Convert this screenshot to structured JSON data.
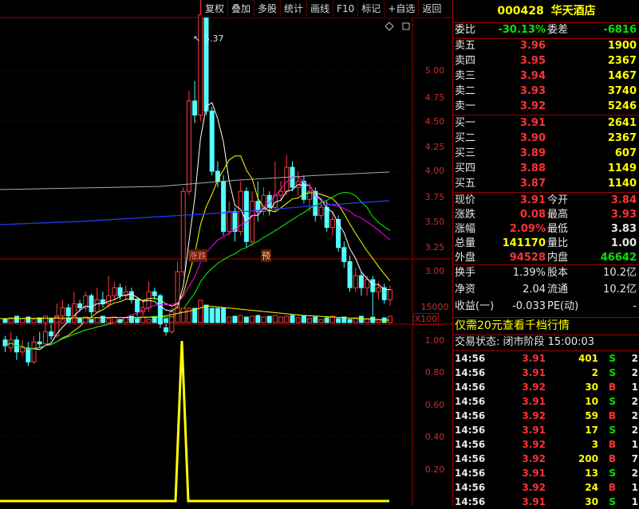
{
  "toolbar": {
    "items": [
      "复权",
      "叠加",
      "多股",
      "统计",
      "画线",
      "F10",
      "标记",
      "+自选",
      "返回"
    ]
  },
  "kline": {
    "axis_labels": [
      "5.00",
      "4.75",
      "4.50",
      "4.25",
      "4.00",
      "3.75",
      "3.50",
      "3.25",
      "3.00"
    ],
    "peak_label": "5.37",
    "markers": [
      "涨跌",
      "预"
    ],
    "volume_axis": "15000",
    "volume_unit": "X100",
    "indicator_axis": [
      "1.00",
      "0.80",
      "0.60",
      "0.40",
      "0.20"
    ],
    "colors": {
      "up": "#ff3c3c",
      "down": "#54ffff",
      "ma5": "#ffffff",
      "ma10": "#ffff00",
      "ma20": "#ff00ff",
      "ma30": "#00ff00",
      "ma60": "#ffffff",
      "ma120": "#2040ff",
      "indicator": "#ffff00",
      "grid": "#a00000"
    }
  },
  "quote": {
    "code": "000428",
    "name": "华天酒店",
    "weibi_label": "委比",
    "weibi_value": "-30.13%",
    "weicha_label": "委差",
    "weicha_value": "-6816",
    "asks": [
      {
        "label": "卖五",
        "price": "3.96",
        "vol": "1900"
      },
      {
        "label": "卖四",
        "price": "3.95",
        "vol": "2367"
      },
      {
        "label": "卖三",
        "price": "3.94",
        "vol": "1467"
      },
      {
        "label": "卖二",
        "price": "3.93",
        "vol": "3740"
      },
      {
        "label": "卖一",
        "price": "3.92",
        "vol": "5246"
      }
    ],
    "bids": [
      {
        "label": "买一",
        "price": "3.91",
        "vol": "2641"
      },
      {
        "label": "买二",
        "price": "3.90",
        "vol": "2367"
      },
      {
        "label": "买三",
        "price": "3.89",
        "vol": "607"
      },
      {
        "label": "买四",
        "price": "3.88",
        "vol": "1149"
      },
      {
        "label": "买五",
        "price": "3.87",
        "vol": "1140"
      }
    ],
    "stats": [
      {
        "l1": "现价",
        "v1": "3.91",
        "l2": "今开",
        "v2": "3.84",
        "c1": "red",
        "c2": "red"
      },
      {
        "l1": "涨跌",
        "v1": "0.08",
        "l2": "最高",
        "v2": "3.93",
        "c1": "red",
        "c2": "red"
      },
      {
        "l1": "涨幅",
        "v1": "2.09%",
        "l2": "最低",
        "v2": "3.83",
        "c1": "red",
        "c2": "wht"
      },
      {
        "l1": "总量",
        "v1": "141170",
        "l2": "量比",
        "v2": "1.00",
        "c1": "yel",
        "c2": "wht"
      },
      {
        "l1": "外盘",
        "v1": "94528",
        "l2": "内盘",
        "v2": "46642",
        "c1": "red",
        "c2": "green"
      }
    ],
    "stats2": [
      {
        "l1": "换手",
        "v1": "1.39%",
        "l2": "股本",
        "v2": "10.2亿"
      },
      {
        "l1": "净资",
        "v1": "2.04",
        "l2": "流通",
        "v2": "10.2亿"
      },
      {
        "l1": "收益(一)",
        "v1": "-0.033",
        "l2": "PE(动)",
        "v2": "-"
      }
    ],
    "promo": "仅需20元查看千档行情",
    "trade_status": "交易状态: 闭市阶段 15:00:03",
    "ticks": [
      {
        "t": "14:56",
        "p": "3.91",
        "v": "401",
        "s": "S",
        "n": "2"
      },
      {
        "t": "14:56",
        "p": "3.91",
        "v": "2",
        "s": "S",
        "n": "2"
      },
      {
        "t": "14:56",
        "p": "3.92",
        "v": "30",
        "s": "B",
        "n": "1"
      },
      {
        "t": "14:56",
        "p": "3.91",
        "v": "10",
        "s": "S",
        "n": "2"
      },
      {
        "t": "14:56",
        "p": "3.92",
        "v": "59",
        "s": "B",
        "n": "2"
      },
      {
        "t": "14:56",
        "p": "3.91",
        "v": "17",
        "s": "S",
        "n": "2"
      },
      {
        "t": "14:56",
        "p": "3.92",
        "v": "3",
        "s": "B",
        "n": "1"
      },
      {
        "t": "14:56",
        "p": "3.92",
        "v": "200",
        "s": "B",
        "n": "7"
      },
      {
        "t": "14:56",
        "p": "3.91",
        "v": "13",
        "s": "S",
        "n": "2"
      },
      {
        "t": "14:56",
        "p": "3.92",
        "v": "24",
        "s": "B",
        "n": "1"
      },
      {
        "t": "14:56",
        "p": "3.91",
        "v": "30",
        "s": "S",
        "n": "1"
      }
    ]
  }
}
